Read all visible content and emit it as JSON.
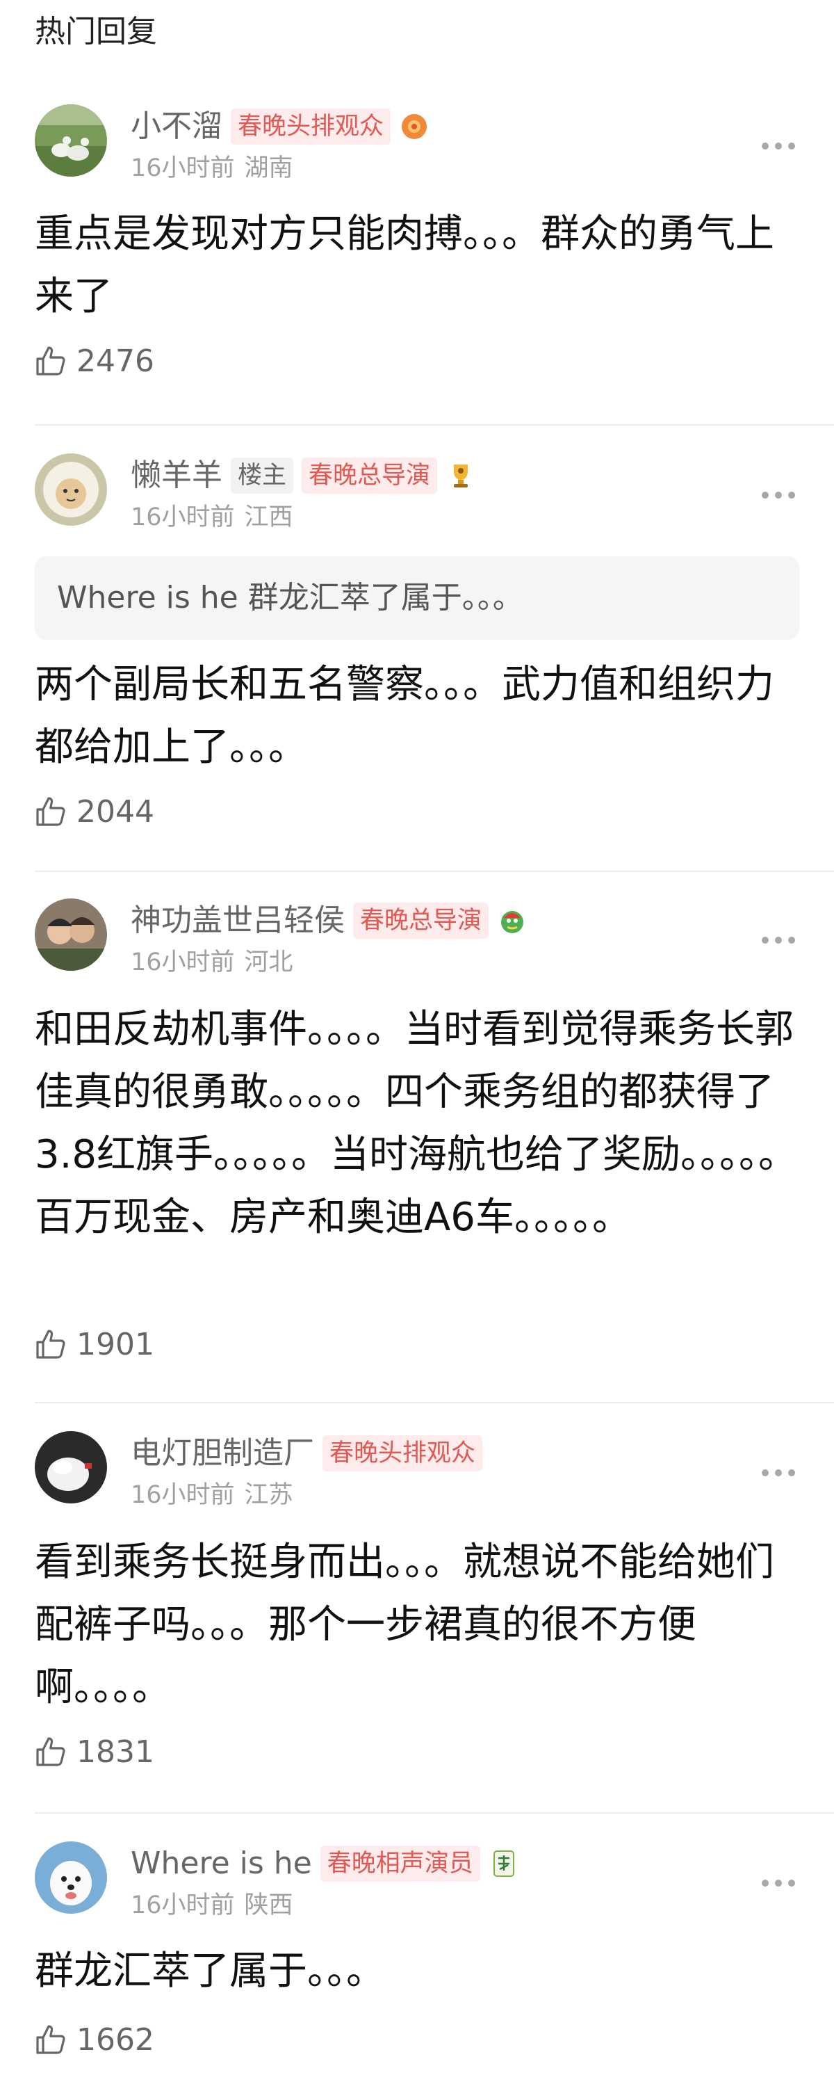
{
  "section_title": "热门回复",
  "comments": [
    {
      "username": "小不溜",
      "badge": "春晚头排观众",
      "medal_icon": "flower-medal-icon",
      "time": "16小时前",
      "location": "湖南",
      "text": "重点是发现对方只能肉搏。。。群众的勇气上来了",
      "likes": "2476"
    },
    {
      "username": "懒羊羊",
      "op_badge": "楼主",
      "badge": "春晚总导演",
      "medal_icon": "trophy-medal-icon",
      "time": "16小时前",
      "location": "江西",
      "quote": "Where is he 群龙汇萃了属于。。。",
      "text": "两个副局长和五名警察。。。武力值和组织力都给加上了。。。",
      "likes": "2044"
    },
    {
      "username": "神功盖世吕轻侯",
      "badge": "春晚总导演",
      "medal_icon": "dragon-medal-icon",
      "time": "16小时前",
      "location": "河北",
      "text": "和田反劫机事件。。。。当时看到觉得乘务长郭佳真的很勇敢。。。。。四个乘务组的都获得了3.8红旗手。。。。。当时海航也给了奖励。。。。。百万现金、房产和奥迪A6车。。。。。",
      "likes": "1901"
    },
    {
      "username": "电灯胆制造厂",
      "badge": "春晚头排观众",
      "time": "16小时前",
      "location": "江苏",
      "text": "看到乘务长挺身而出。。。就想说不能给她们配裤子吗。。。那个一步裙真的很不方便啊。。。。",
      "likes": "1831"
    },
    {
      "username": "Where is he",
      "badge": "春晚相声演员",
      "medal_icon": "mahjong-fa-icon",
      "time": "16小时前",
      "location": "陕西",
      "text": "群龙汇萃了属于。。。",
      "likes": "1662"
    }
  ]
}
